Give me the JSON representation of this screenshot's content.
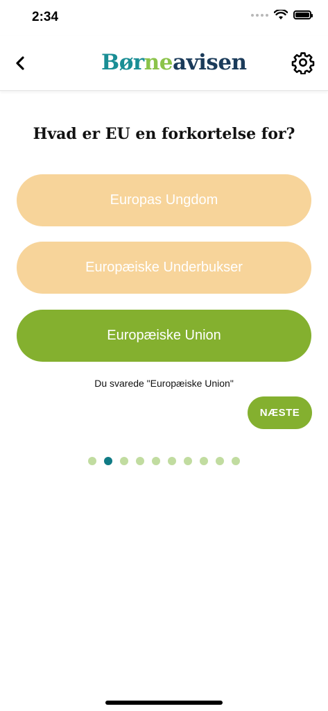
{
  "status_bar": {
    "time": "2:34"
  },
  "header": {
    "logo_part1": "Bør",
    "logo_part2": "ne",
    "logo_part3": "avisen",
    "back_icon": "chevron-left-icon",
    "settings_icon": "gear-icon"
  },
  "quiz": {
    "question": "Hvad er EU en forkortelse for?",
    "answers": [
      {
        "label": "Europas Ungdom",
        "selected": false
      },
      {
        "label": "Europæiske Underbukser",
        "selected": false
      },
      {
        "label": "Europæiske Union",
        "selected": true
      }
    ],
    "feedback": "Du svarede \"Europæiske Union\"",
    "next_label": "NÆSTE",
    "progress": {
      "total": 10,
      "current": 2
    }
  },
  "colors": {
    "accent_green": "#84b02f",
    "answer_pale": "#f7d49a",
    "dot_inactive": "#c1dca0",
    "dot_active": "#107b85"
  }
}
